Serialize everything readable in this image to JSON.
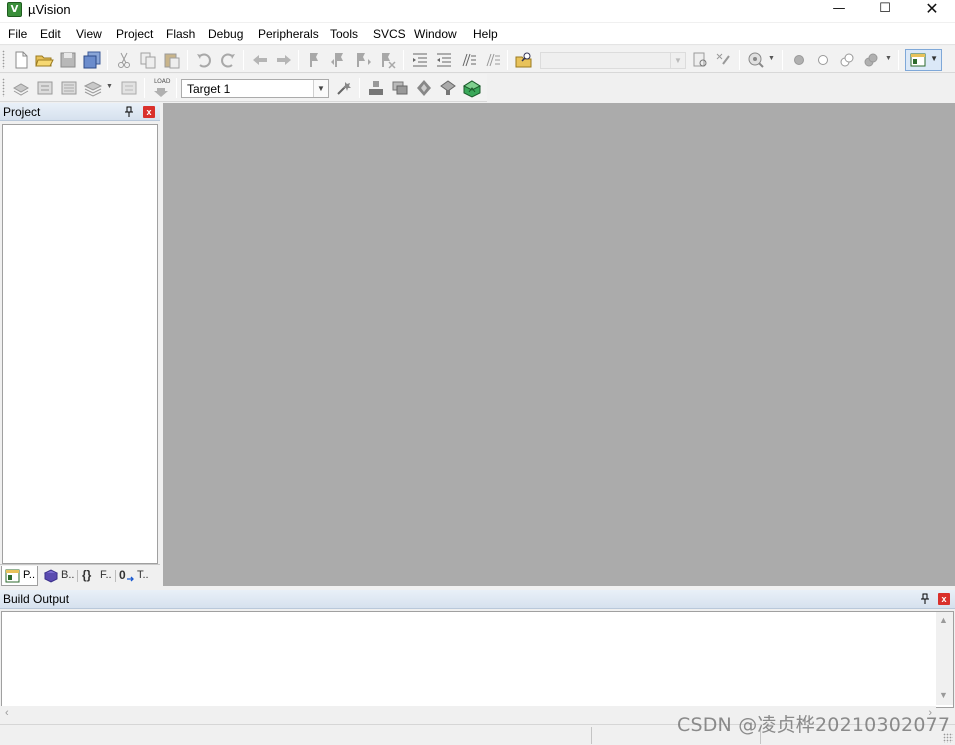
{
  "window": {
    "title": "µVision",
    "app_icon_letter": "V",
    "minimize_glyph": "—",
    "maximize_glyph": "☐",
    "close_glyph": "✕"
  },
  "menu": {
    "items": [
      "File",
      "Edit",
      "View",
      "Project",
      "Flash",
      "Debug",
      "Peripherals",
      "Tools",
      "SVCS",
      "Window",
      "Help"
    ]
  },
  "toolbar_build": {
    "target_name": "Target 1",
    "load_label": "LOAD"
  },
  "project_panel": {
    "title": "Project",
    "pin_glyph": "📌",
    "close_glyph": "x",
    "tabs": [
      {
        "label": "P..",
        "icon": "project-icon"
      },
      {
        "label": "B..",
        "icon": "books-icon"
      },
      {
        "label": "F..",
        "icon": "functions-icon"
      },
      {
        "label": "T..",
        "icon": "templates-icon"
      }
    ],
    "functions_glyph": "{}",
    "templates_glyph": "0"
  },
  "build_output": {
    "title": "Build Output",
    "pin_glyph": "📌",
    "close_glyph": "x",
    "content": ""
  },
  "watermark": "CSDN @凌贞桦20210302077",
  "colors": {
    "editor_background": "#ababab",
    "panel_header": "#d6e1ee",
    "close_red": "#d9302c"
  }
}
